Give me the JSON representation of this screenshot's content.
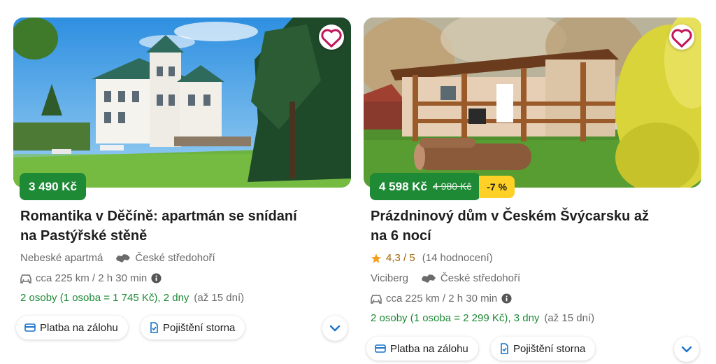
{
  "listings": [
    {
      "price": "3 490 Kč",
      "title_line1": "Romantika v Děčíně: apartmán se snídaní",
      "title_line2": "na Pastýřské stěně",
      "provider": "Nebeské apartmá",
      "region": "České středohoří",
      "distance": "cca 225 km / 2 h 30 min",
      "stay_summary": "2 osoby (1 osoba = 1 745 Kč), 2 dny",
      "validity": "(až 15 dní)",
      "badges": [
        "Platba na zálohu",
        "Pojištění storna"
      ]
    },
    {
      "price": "4 598 Kč",
      "old_price": "4 980 Kč",
      "discount": "-7 %",
      "title_line1": "Prázdninový dům v Českém Švýcarsku až",
      "title_line2": "na 6 nocí",
      "rating": "4,3 / 5",
      "reviews": "(14 hodnocení)",
      "provider": "Viciberg",
      "region": "České středohoří",
      "distance": "cca 225 km / 2 h 30 min",
      "stay_summary": "2 osoby (1 osoba = 2 299 Kč), 3 dny",
      "validity": "(až 15 dní)",
      "badges": [
        "Platba na zálohu",
        "Pojištění storna"
      ]
    }
  ],
  "colors": {
    "price_green": "#1e8a36",
    "discount_yellow": "#ffd025",
    "link_blue": "#1a73c9"
  },
  "icons": [
    "heart-icon",
    "star-icon",
    "region-map-icon",
    "car-icon",
    "info-icon",
    "payment-card-icon",
    "insurance-icon",
    "chevron-down-icon"
  ]
}
